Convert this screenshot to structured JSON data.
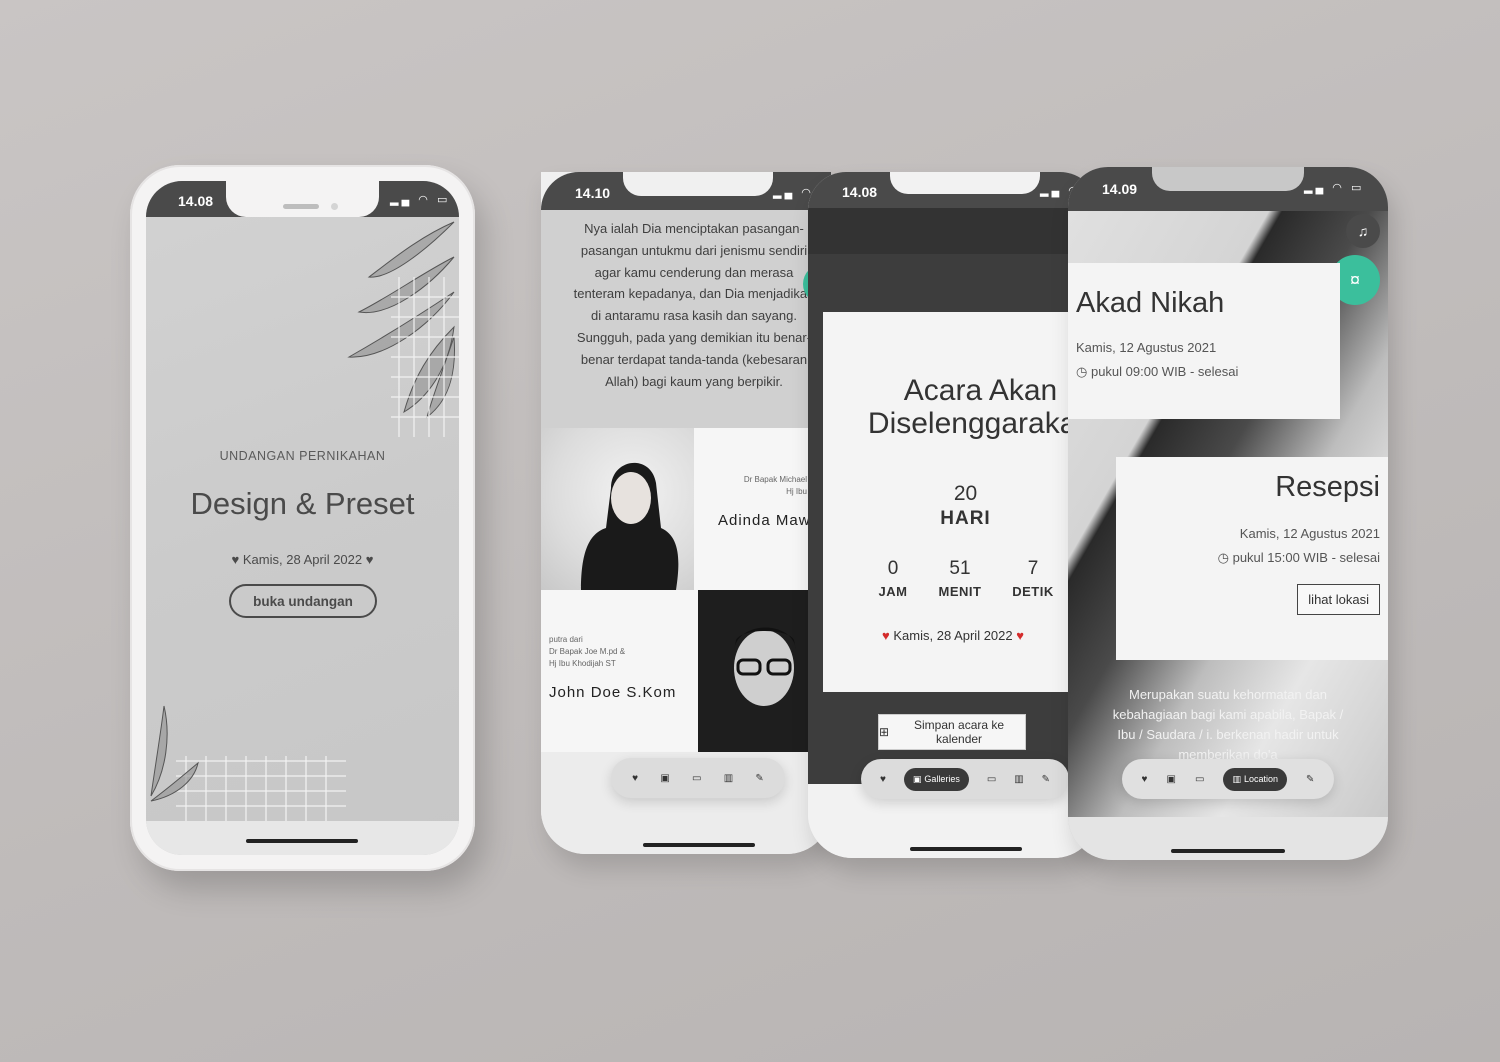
{
  "phone1": {
    "status_time": "14.08",
    "label": "UNDANGAN PERNIKAHAN",
    "title": "Design & Preset",
    "date": "Kamis, 28 April 2022",
    "open_button": "buka undangan"
  },
  "phone2": {
    "status_time": "14.10",
    "quote": "Nya ialah Dia menciptakan pasangan-pasangan untukmu dari jenismu sendiri agar kamu cenderung dan merasa tenteram kepadanya, dan Dia menjadikan di antaramu rasa kasih dan sayang. Sungguh, pada yang demikian itu benar-benar terdapat tanda-tanda (kebesaran Allah) bagi kaum yang berpikir.",
    "bride": {
      "parents_line1": "Dr Bapak Michael",
      "parents_line2": "Hj Ibu",
      "name": "Adinda Maw"
    },
    "groom": {
      "prefix": "putra dari",
      "parents_line1": "Dr Bapak Joe M.pd &",
      "parents_line2": "Hj Ibu Khodijah ST",
      "name": "John Doe S.Kom"
    }
  },
  "phone3": {
    "status_time": "14.08",
    "title": "Acara Akan Diselenggarakan",
    "days": "20",
    "days_label": "HARI",
    "hours": "0",
    "hours_label": "JAM",
    "minutes": "51",
    "minutes_label": "MENIT",
    "seconds": "7",
    "seconds_label": "DETIK",
    "date": "Kamis, 28 April 2022",
    "save_button": "Simpan acara ke kalender",
    "nav_active_label": "Galleries"
  },
  "phone4": {
    "status_time": "14.09",
    "akad": {
      "title": "Akad Nikah",
      "date": "Kamis, 12 Agustus 2021",
      "time": "pukul 09:00 WIB - selesai"
    },
    "resepsi": {
      "title": "Resepsi",
      "date": "Kamis, 12 Agustus 2021",
      "time": "pukul 15:00 WIB - selesai",
      "location_button": "lihat lokasi"
    },
    "footer_text": "Merupakan suatu kehormatan dan kebahagiaan bagi kami apabila, Bapak / Ibu / Saudara / i. berkenan hadir untuk memberikan do'a",
    "nav_active_label": "Location"
  },
  "colors": {
    "accent_green": "#3bbf9c",
    "heart_red": "#d42b2b",
    "dark": "#4a4a4a"
  }
}
